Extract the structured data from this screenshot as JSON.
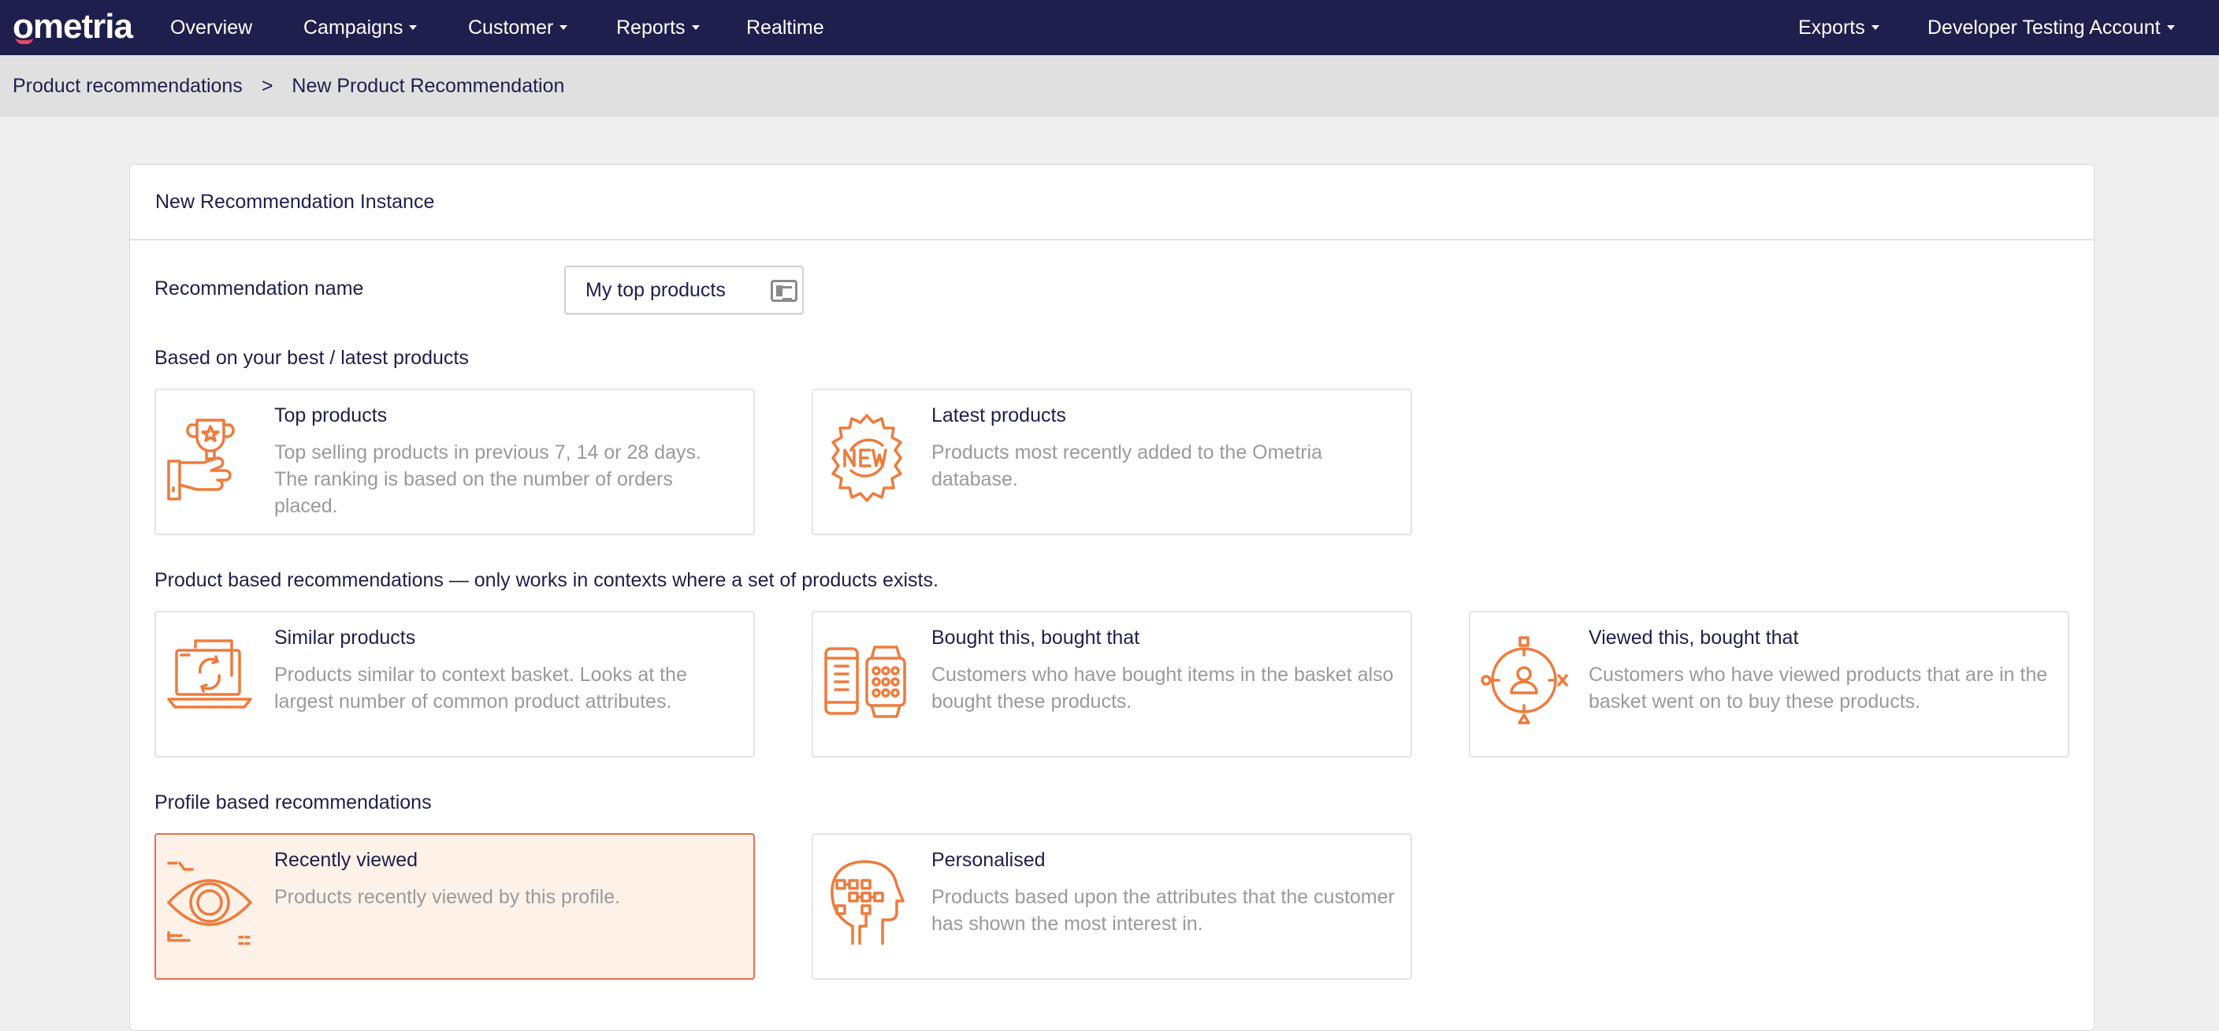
{
  "nav": {
    "logo": "ometria",
    "items": [
      "Overview",
      "Campaigns",
      "Customer",
      "Reports",
      "Realtime"
    ],
    "right_items": [
      "Exports",
      "Developer Testing Account"
    ]
  },
  "breadcrumb": {
    "parent": "Product recommendations",
    "separator": ">",
    "current": "New Product Recommendation"
  },
  "panel": {
    "title": "New Recommendation Instance",
    "name_label": "Recommendation name",
    "name_value": "My top products"
  },
  "sections": [
    {
      "heading": "Based on your best / latest products",
      "cards": [
        {
          "title": "Top products",
          "desc": "Top selling products in previous 7, 14 or 28 days. The ranking is based on the number of orders placed.",
          "icon": "trophy-hand-icon"
        },
        {
          "title": "Latest products",
          "desc": "Products most recently added to the Ometria database.",
          "icon": "new-badge-icon"
        }
      ]
    },
    {
      "heading": "Product based recommendations — only works in contexts where a set of products exists.",
      "cards": [
        {
          "title": "Similar products",
          "desc": "Products similar to context basket. Looks at the largest number of common product attributes.",
          "icon": "laptop-sync-icon"
        },
        {
          "title": "Bought this, bought that",
          "desc": "Customers who have bought items in the basket also bought these products.",
          "icon": "phone-watch-icon"
        },
        {
          "title": "Viewed this, bought that",
          "desc": "Customers who have viewed products that are in the basket went on to buy these products.",
          "icon": "target-user-icon"
        }
      ]
    },
    {
      "heading": "Profile based recommendations",
      "cards": [
        {
          "title": "Recently viewed",
          "desc": "Products recently viewed by this profile.",
          "icon": "eye-icon"
        },
        {
          "title": "Personalised",
          "desc": "Products based upon the attributes that the customer has shown the most interest in.",
          "icon": "head-circuit-icon"
        }
      ]
    }
  ],
  "colors": {
    "nav_bg": "#1f1f4d",
    "accent_orange": "#ee7b3c",
    "selected_bg": "#fdf1e8",
    "selected_border": "#ee6a52"
  }
}
